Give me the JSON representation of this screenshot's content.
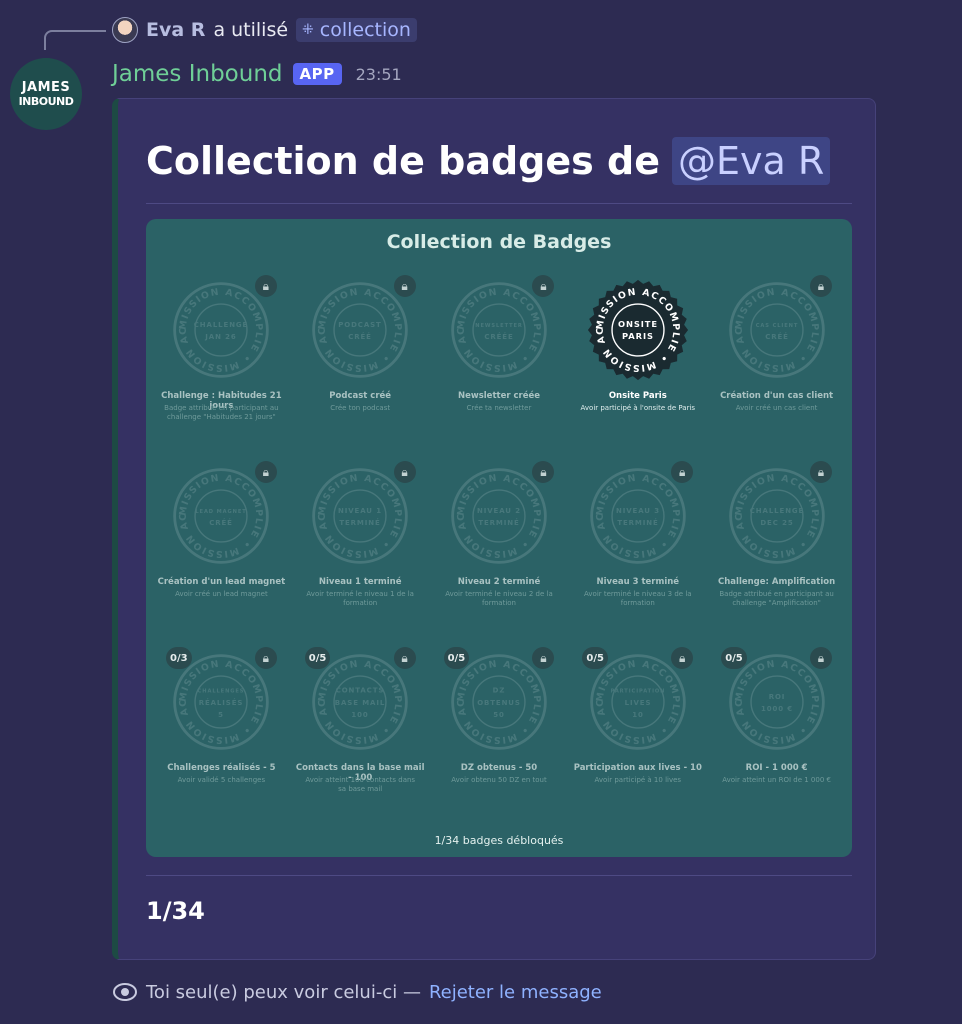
{
  "reply": {
    "user_name": "Eva R",
    "action_text": "a utilisé",
    "command_name": "collection",
    "command_icon": "slash-command-icon"
  },
  "bot": {
    "avatar_line1": "JAMES",
    "avatar_line2": "INBOUND",
    "name": "James Inbound",
    "app_label": "APP",
    "timestamp": "23:51"
  },
  "embed": {
    "title_prefix": "Collection de badges de",
    "mention": "@Eva R",
    "accent_color": "#1d4a44",
    "footer": "1/34"
  },
  "badge_panel": {
    "title": "Collection de Badges",
    "summary": "1/34 badges débloqués",
    "ring_text": "MISSION ACCOMPLIE",
    "badges": [
      {
        "center": [
          "CHALLENGE",
          "JAN 26"
        ],
        "name": "Challenge : Habitudes 21 jours",
        "desc": "Badge attribué en participant au challenge \"Habitudes 21 jours\"",
        "unlocked": false,
        "progress": ""
      },
      {
        "center": [
          "PODCAST",
          "CRÉÉ"
        ],
        "name": "Podcast créé",
        "desc": "Crée ton podcast",
        "unlocked": false,
        "progress": ""
      },
      {
        "center": [
          "NEWSLETTER",
          "CRÉÉE"
        ],
        "name": "Newsletter créée",
        "desc": "Crée ta newsletter",
        "unlocked": false,
        "progress": ""
      },
      {
        "center": [
          "ONSITE",
          "PARIS"
        ],
        "name": "Onsite Paris",
        "desc": "Avoir participé à l'onsite de Paris",
        "unlocked": true,
        "progress": ""
      },
      {
        "center": [
          "CAS CLIENT",
          "CRÉÉ"
        ],
        "name": "Création d'un cas client",
        "desc": "Avoir créé un cas client",
        "unlocked": false,
        "progress": ""
      },
      {
        "center": [
          "LEAD MAGNET",
          "CRÉÉ"
        ],
        "name": "Création d'un lead magnet",
        "desc": "Avoir créé un lead magnet",
        "unlocked": false,
        "progress": ""
      },
      {
        "center": [
          "NIVEAU 1",
          "TERMINÉ"
        ],
        "name": "Niveau 1 terminé",
        "desc": "Avoir terminé le niveau 1 de la formation",
        "unlocked": false,
        "progress": ""
      },
      {
        "center": [
          "NIVEAU 2",
          "TERMINÉ"
        ],
        "name": "Niveau 2 terminé",
        "desc": "Avoir terminé le niveau 2 de la formation",
        "unlocked": false,
        "progress": ""
      },
      {
        "center": [
          "NIVEAU 3",
          "TERMINÉ"
        ],
        "name": "Niveau 3 terminé",
        "desc": "Avoir terminé le niveau 3 de la formation",
        "unlocked": false,
        "progress": ""
      },
      {
        "center": [
          "CHALLENGE",
          "DEC 25"
        ],
        "name": "Challenge: Amplification",
        "desc": "Badge attribué en participant au challenge \"Amplification\"",
        "unlocked": false,
        "progress": ""
      },
      {
        "center": [
          "CHALLENGES",
          "RÉALISÉS",
          "5"
        ],
        "name": "Challenges réalisés - 5",
        "desc": "Avoir validé 5 challenges",
        "unlocked": false,
        "progress": "0/3"
      },
      {
        "center": [
          "CONTACTS",
          "BASE MAIL",
          "100"
        ],
        "name": "Contacts dans la base mail - 100",
        "desc": "Avoir atteint 100 contacts dans sa base mail",
        "unlocked": false,
        "progress": "0/5"
      },
      {
        "center": [
          "DZ",
          "OBTENUS",
          "50"
        ],
        "name": "DZ obtenus - 50",
        "desc": "Avoir obtenu 50 DZ en tout",
        "unlocked": false,
        "progress": "0/5"
      },
      {
        "center": [
          "PARTICIPATION",
          "LIVES",
          "10"
        ],
        "name": "Participation aux lives - 10",
        "desc": "Avoir participé à 10 lives",
        "unlocked": false,
        "progress": "0/5"
      },
      {
        "center": [
          "ROI",
          "1000 €"
        ],
        "name": "ROI - 1 000 €",
        "desc": "Avoir atteint un ROI de 1 000 €",
        "unlocked": false,
        "progress": "0/5"
      }
    ]
  },
  "ephemeral": {
    "notice": "Toi seul(e) peux voir celui-ci —",
    "dismiss_label": "Rejeter le message"
  }
}
